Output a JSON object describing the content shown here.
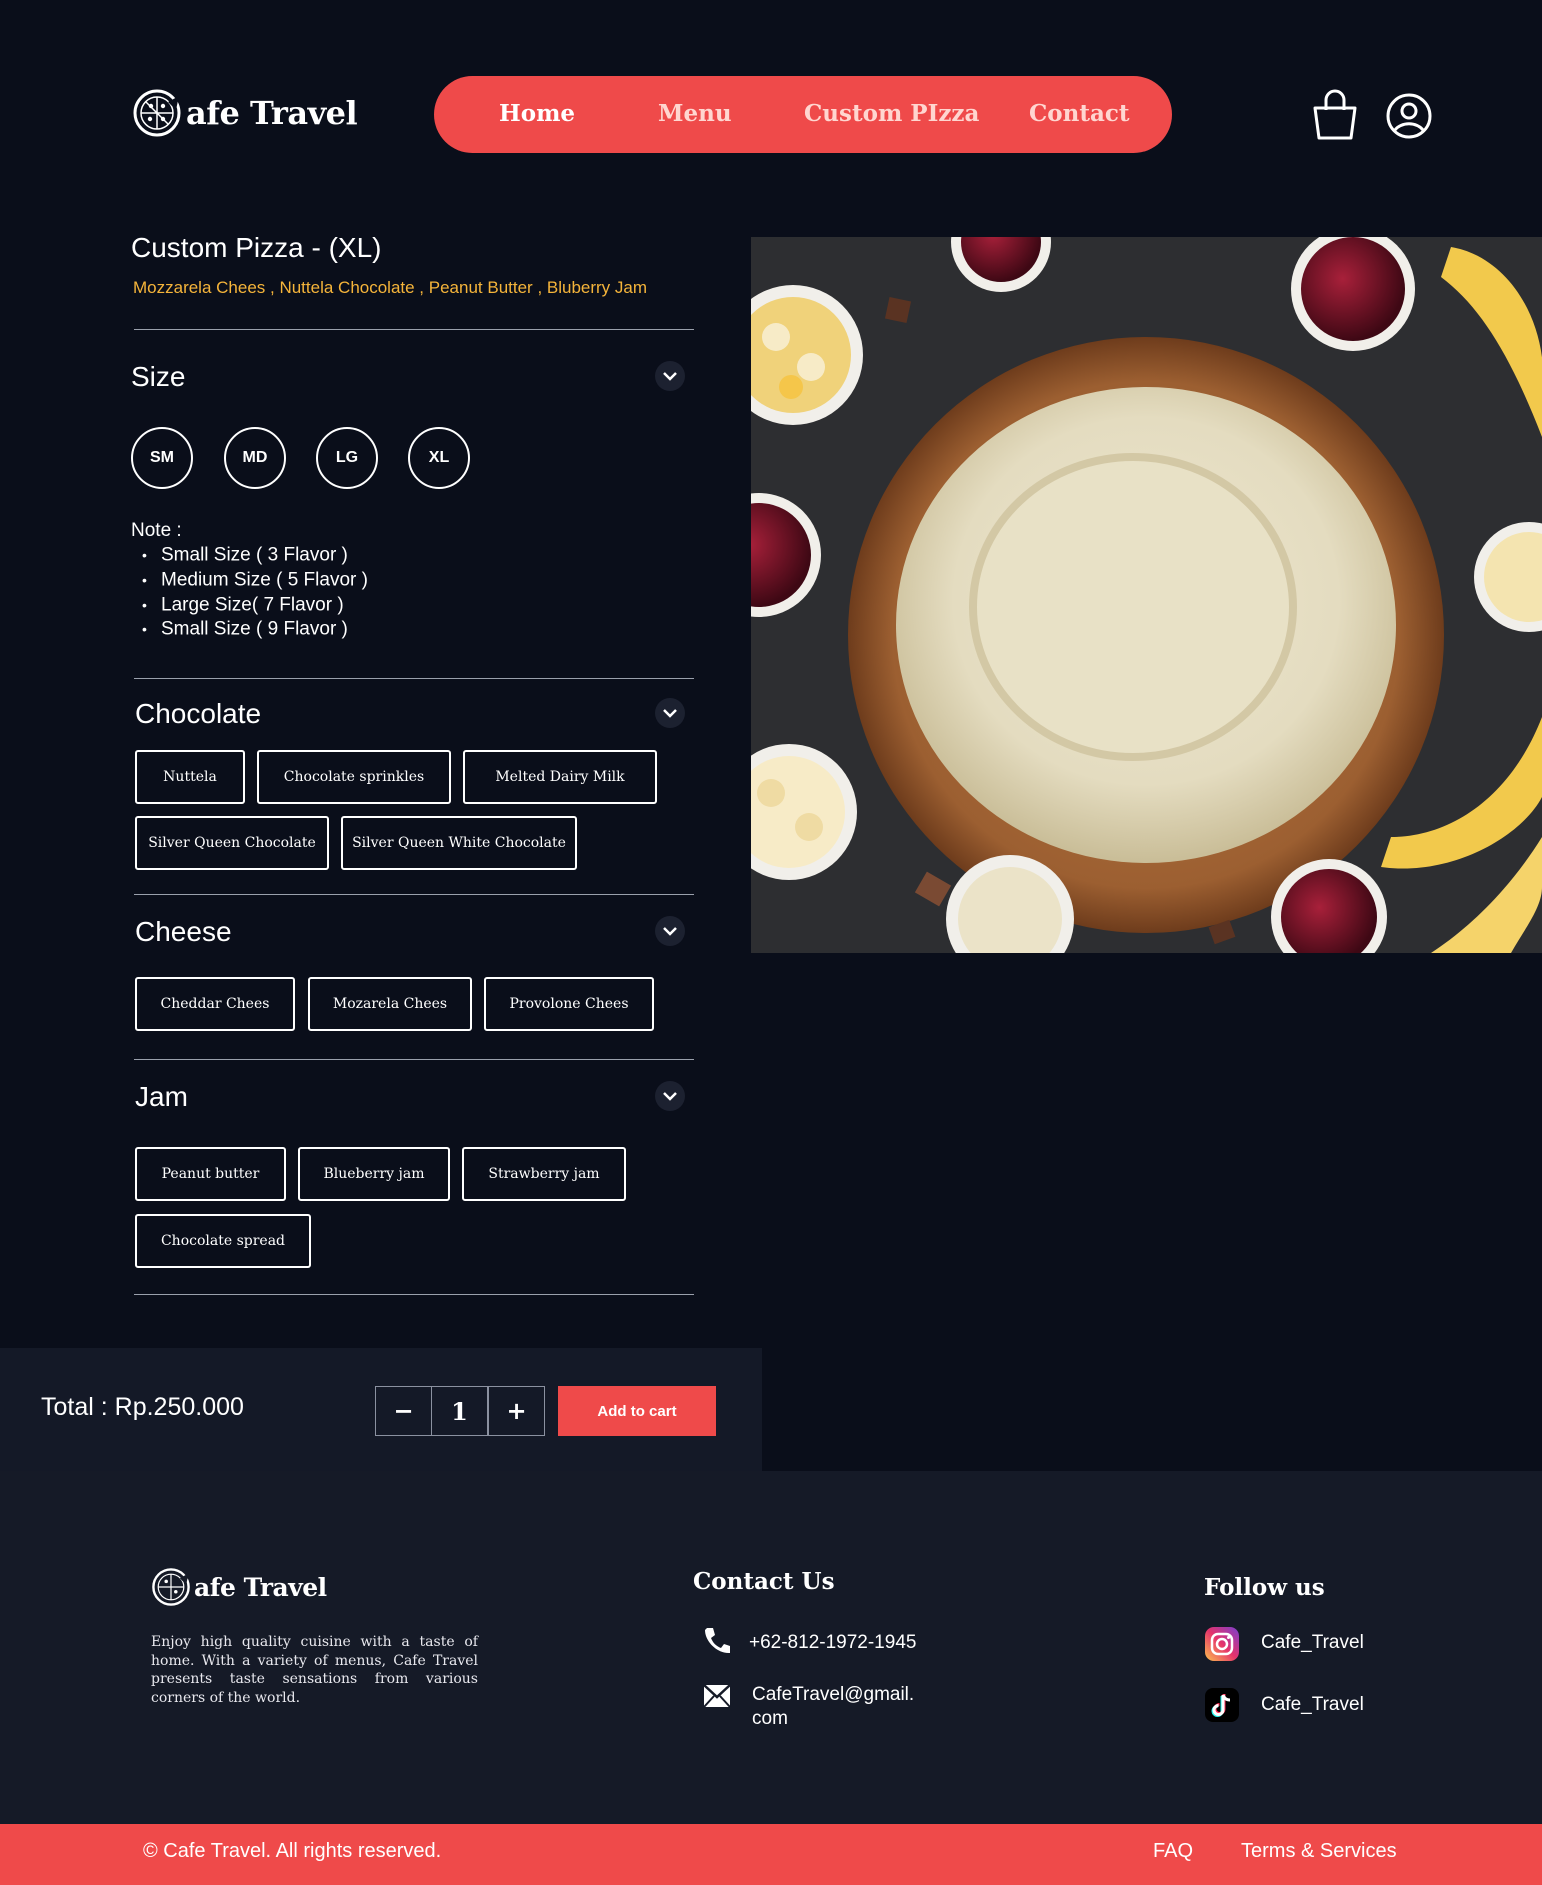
{
  "brand": {
    "name": "afe Travel",
    "accent": "#ef4a4a",
    "highlight": "#f5b43a",
    "background": "#0a0e1a"
  },
  "nav": {
    "items": [
      "Home",
      "Menu",
      "Custom PIzza",
      "Contact"
    ],
    "active": "Home"
  },
  "header_icons": [
    "shopping-bag-icon",
    "user-profile-icon"
  ],
  "product": {
    "title": "Custom Pizza - (XL)",
    "selected_toppings": "Mozzarela Chees , Nuttela Chocolate , Peanut Butter , Bluberry Jam"
  },
  "size": {
    "title": "Size",
    "options": [
      "SM",
      "MD",
      "LG",
      "XL"
    ],
    "note_label": "Note :",
    "notes": [
      "Small Size ( 3 Flavor )",
      "Medium Size ( 5 Flavor )",
      "Large Size( 7 Flavor )",
      "Small Size ( 9 Flavor )"
    ]
  },
  "chocolate": {
    "title": "Chocolate",
    "options": [
      "Nuttela",
      "Chocolate sprinkles",
      "Melted Dairy Milk",
      "Silver Queen Chocolate",
      "Silver Queen White Chocolate"
    ]
  },
  "cheese": {
    "title": "Cheese",
    "options": [
      "Cheddar Chees",
      "Mozarela Chees",
      "Provolone Chees"
    ]
  },
  "jam": {
    "title": "Jam",
    "options": [
      "Peanut butter",
      "Blueberry jam",
      "Strawberry jam",
      "Chocolate spread"
    ]
  },
  "order": {
    "total_label": "Total : Rp.250.000",
    "minus": "−",
    "quantity": "1",
    "plus": "+",
    "add_to_cart": "Add to cart"
  },
  "footer": {
    "brand": "afe Travel",
    "description": "Enjoy high quality cuisine with a taste of home. With a variety of menus, Cafe Travel presents taste sensations from various corners of the world.",
    "contact_title": "Contact Us",
    "phone": "+62-812-1972-1945",
    "email_line1": "CafeTravel@gmail.",
    "email_line2": "com",
    "follow_title": "Follow us",
    "instagram": "Cafe_Travel",
    "tiktok": "Cafe_Travel"
  },
  "bottom": {
    "copyright": "© Cafe Travel. All rights reserved.",
    "faq": "FAQ",
    "terms": "Terms & Services"
  }
}
